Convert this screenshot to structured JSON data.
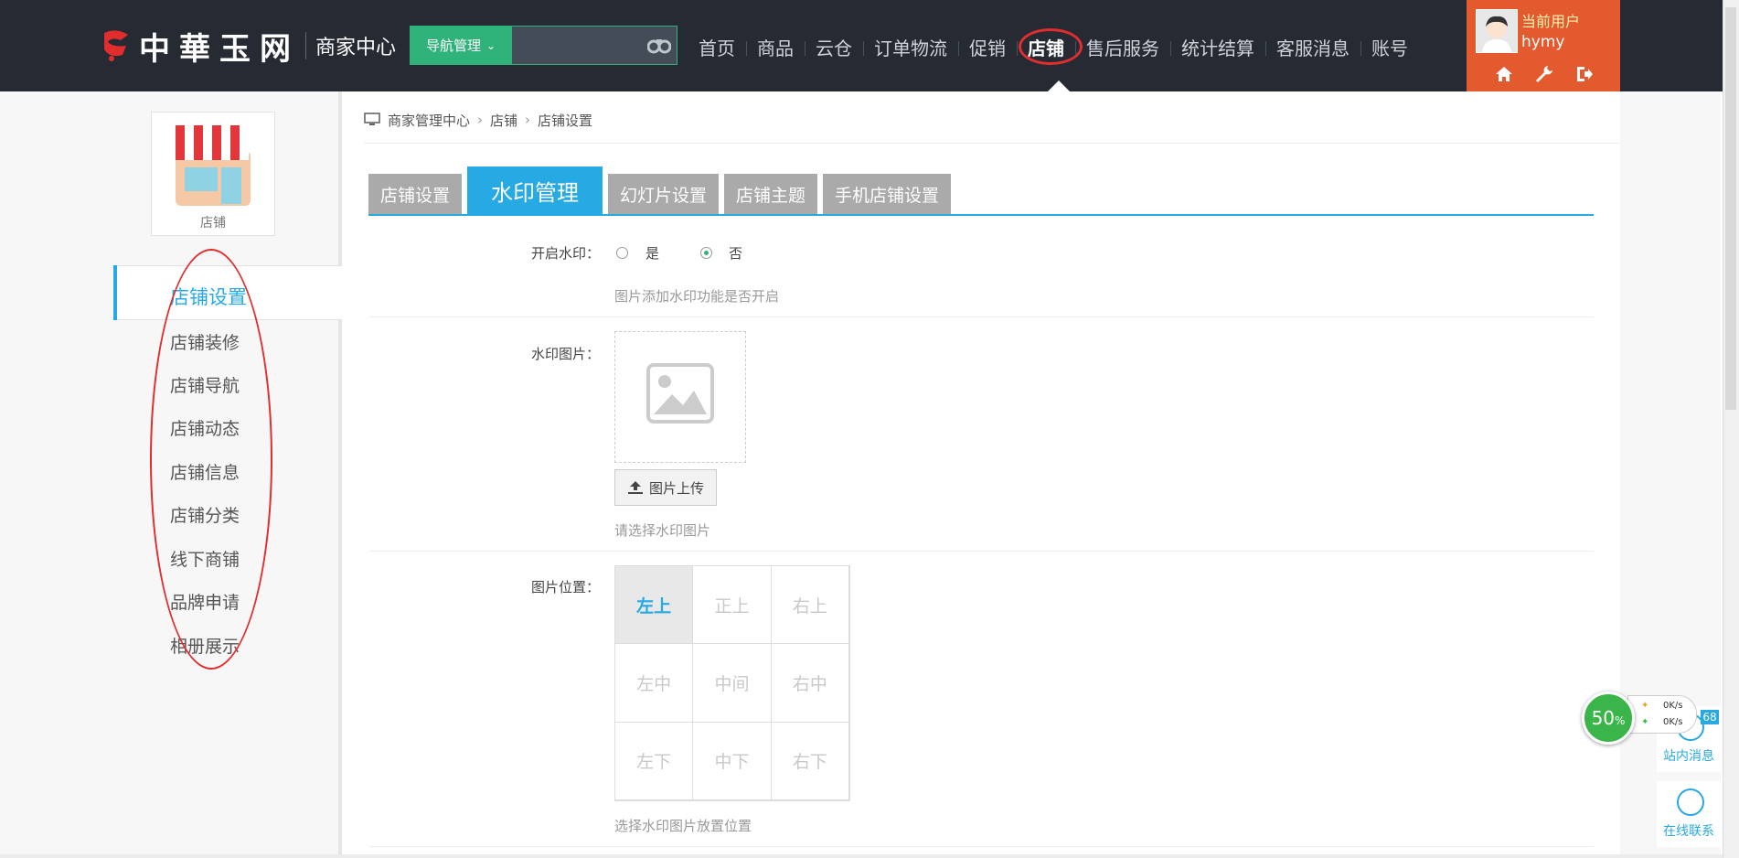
{
  "header": {
    "site_name": "中華玉网",
    "center_label": "商家中心",
    "nav_manage_label": "导航管理",
    "search_placeholder": "",
    "nav": [
      "首页",
      "商品",
      "云仓",
      "订单物流",
      "促销",
      "店铺",
      "售后服务",
      "统计结算",
      "客服消息",
      "账号"
    ],
    "active_nav": "店铺",
    "user": {
      "label": "当前用户",
      "name": "hymy"
    },
    "accent": "#e25a2d",
    "bg": "#252a33"
  },
  "sidebar": {
    "store_label": "店铺",
    "items": [
      "店铺设置",
      "店铺装修",
      "店铺导航",
      "店铺动态",
      "店铺信息",
      "店铺分类",
      "线下商铺",
      "品牌申请",
      "相册展示"
    ],
    "active": "店铺设置"
  },
  "breadcrumb": [
    "商家管理中心",
    "店铺",
    "店铺设置"
  ],
  "tabs": [
    "店铺设置",
    "水印管理",
    "幻灯片设置",
    "店铺主题",
    "手机店铺设置"
  ],
  "active_tab": "水印管理",
  "form": {
    "watermark_on": {
      "label": "开启水印：",
      "yes": "是",
      "no": "否",
      "selected": "否",
      "hint": "图片添加水印功能是否开启"
    },
    "watermark_img": {
      "label": "水印图片：",
      "upload": "图片上传",
      "hint": "请选择水印图片"
    },
    "position": {
      "label": "图片位置：",
      "cells": [
        "左上",
        "正上",
        "右上",
        "左中",
        "中间",
        "右中",
        "左下",
        "中下",
        "右下"
      ],
      "selected": "左上",
      "hint": "选择水印图片放置位置"
    }
  },
  "float": {
    "net_percent": "50",
    "net_unit": "%",
    "up": "0K/s",
    "down": "0K/s",
    "msg_badge": "68",
    "msg_label": "站内消息",
    "chat_label": "在线联系"
  },
  "colors": {
    "primary": "#27a9e3",
    "green": "#2fb37a",
    "annotation": "#e12d2d"
  }
}
